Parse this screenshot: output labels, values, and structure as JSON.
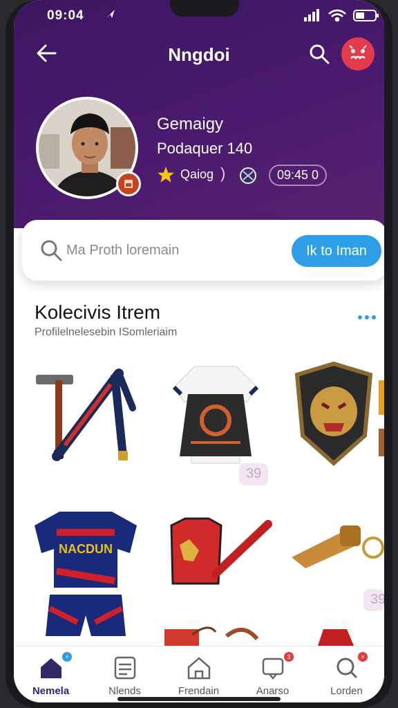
{
  "status_bar": {
    "time": "09:04"
  },
  "header": {
    "title": "Nngdoi"
  },
  "profile": {
    "name": "Gemaigy",
    "subtitle": "Podaquer 140",
    "rating_label": "Qaiog",
    "stat_value": "09:45 0"
  },
  "search": {
    "placeholder": "Ma Proth loremain",
    "button_label": "Ik to Iman"
  },
  "collection": {
    "title": "Kolecivis Itrem",
    "subtitle": "Profilelnelesebin ISomleriaim",
    "badges": [
      "39",
      "39"
    ]
  },
  "items": [
    {
      "name": "hammer-stick"
    },
    {
      "name": "apron-jersey"
    },
    {
      "name": "dragon-shield"
    },
    {
      "name": "football-kit",
      "print": "NACDUN"
    },
    {
      "name": "red-vest-baton"
    },
    {
      "name": "golden-whistle"
    }
  ],
  "tabs": [
    {
      "label": "Nemela",
      "icon": "home-icon",
      "active": true,
      "badge_color": "#2e9ee6"
    },
    {
      "label": "Nlends",
      "icon": "list-icon",
      "active": false
    },
    {
      "label": "Frendain",
      "icon": "house-outline-icon",
      "active": false
    },
    {
      "label": "Anarso",
      "icon": "chat-icon",
      "active": false,
      "badge_color": "#e33a3a"
    },
    {
      "label": "Lorden",
      "icon": "search-tab-icon",
      "active": false,
      "badge_color": "#e33a3a"
    }
  ],
  "colors": {
    "hero": "#4a1a6e",
    "accent": "#2e9ee6",
    "avatar": "#e33a4c"
  }
}
